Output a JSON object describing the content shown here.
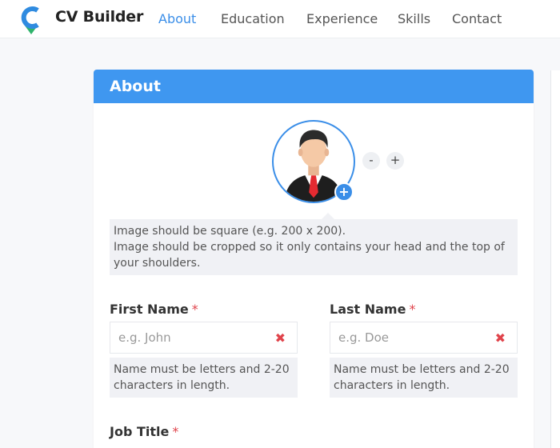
{
  "app": {
    "brand": "CV Builder",
    "logo_icon": "cv-builder-logo-icon",
    "accent_color": "#3f97f0"
  },
  "nav": {
    "items": [
      {
        "label": "About",
        "active": true
      },
      {
        "label": "Education",
        "active": false
      },
      {
        "label": "Experience",
        "active": false
      },
      {
        "label": "Skills",
        "active": false
      },
      {
        "label": "Contact",
        "active": false
      }
    ]
  },
  "about": {
    "title": "About",
    "avatar": {
      "add_label": "+",
      "zoom_out_label": "-",
      "zoom_in_label": "+"
    },
    "image_help": {
      "line1": "Image should be square (e.g. 200 x 200).",
      "line2": "Image should be cropped so it only contains your head and the top of your shoulders."
    },
    "first_name": {
      "label": "First Name",
      "required_mark": "*",
      "value": "",
      "placeholder": "e.g. John",
      "clear_icon": "✖",
      "hint": "Name must be letters and 2-20 characters in length."
    },
    "last_name": {
      "label": "Last Name",
      "required_mark": "*",
      "value": "",
      "placeholder": "e.g. Doe",
      "clear_icon": "✖",
      "hint": "Name must be letters and 2-20 characters in length."
    },
    "job_title": {
      "label": "Job Title",
      "required_mark": "*"
    }
  }
}
